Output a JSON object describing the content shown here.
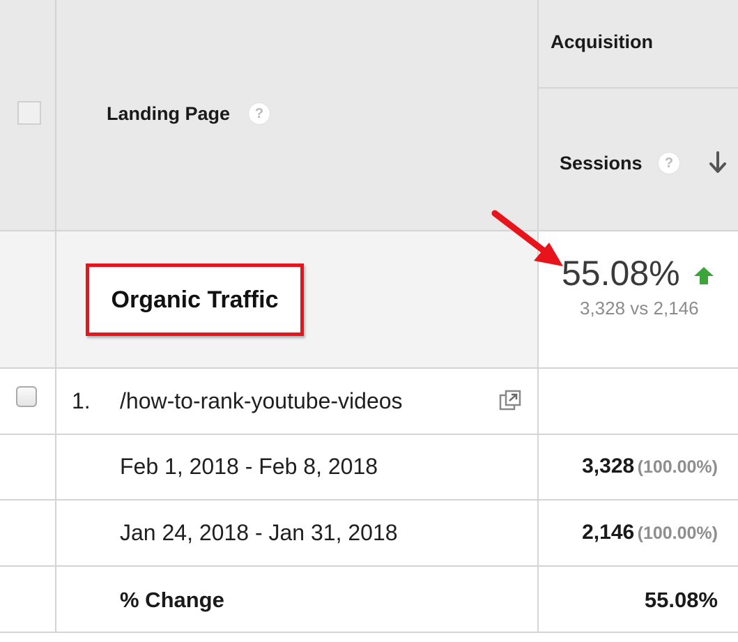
{
  "header": {
    "landing_page_label": "Landing Page",
    "acquisition_label": "Acquisition",
    "sessions_label": "Sessions",
    "help_glyph": "?",
    "sort_icon": "arrow-down-icon"
  },
  "segment": {
    "name": "Organic Traffic",
    "change_pct": "55.08%",
    "comparison": "3,328 vs 2,146",
    "trend": "up",
    "trend_color": "#3ba53b",
    "highlight_color": "#e8141b"
  },
  "rows": [
    {
      "index": "1.",
      "page": "/how-to-rank-youtube-videos",
      "icon": "open-in-new-window-icon"
    }
  ],
  "date_rows": [
    {
      "range": "Feb 1, 2018 - Feb 8, 2018",
      "sessions": "3,328",
      "share": "(100.00%)"
    },
    {
      "range": "Jan 24, 2018 - Jan 31, 2018",
      "sessions": "2,146",
      "share": "(100.00%)"
    }
  ],
  "change_row": {
    "label": "% Change",
    "value": "55.08%"
  }
}
